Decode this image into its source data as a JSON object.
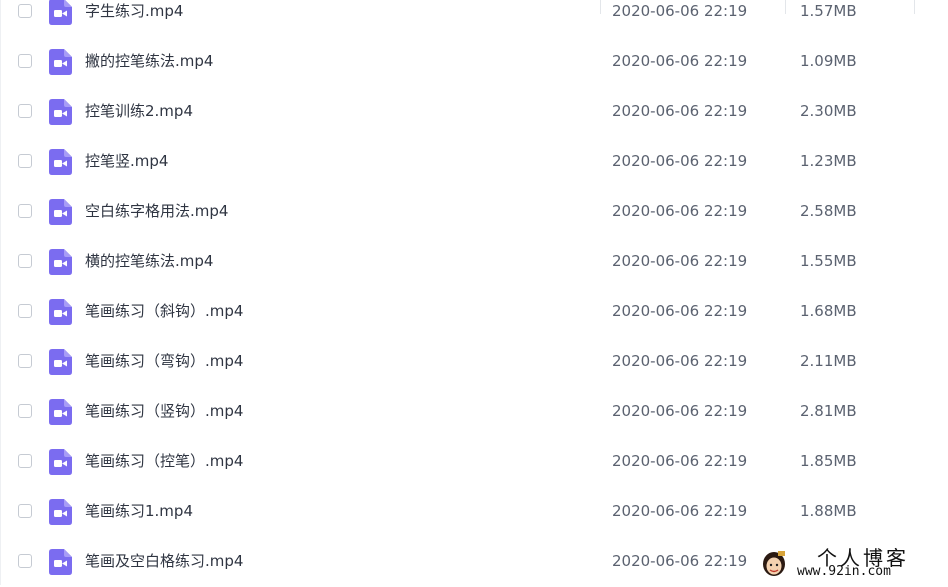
{
  "files": [
    {
      "name": "字生练习.mp4",
      "date": "2020-06-06 22:19",
      "size": "1.57MB"
    },
    {
      "name": "撇的控笔练法.mp4",
      "date": "2020-06-06 22:19",
      "size": "1.09MB"
    },
    {
      "name": "控笔训练2.mp4",
      "date": "2020-06-06 22:19",
      "size": "2.30MB"
    },
    {
      "name": "控笔竖.mp4",
      "date": "2020-06-06 22:19",
      "size": "1.23MB"
    },
    {
      "name": "空白练字格用法.mp4",
      "date": "2020-06-06 22:19",
      "size": "2.58MB"
    },
    {
      "name": "横的控笔练法.mp4",
      "date": "2020-06-06 22:19",
      "size": "1.55MB"
    },
    {
      "name": "笔画练习（斜钩）.mp4",
      "date": "2020-06-06 22:19",
      "size": "1.68MB"
    },
    {
      "name": "笔画练习（弯钩）.mp4",
      "date": "2020-06-06 22:19",
      "size": "2.11MB"
    },
    {
      "name": "笔画练习（竖钩）.mp4",
      "date": "2020-06-06 22:19",
      "size": "2.81MB"
    },
    {
      "name": "笔画练习（控笔）.mp4",
      "date": "2020-06-06 22:19",
      "size": "1.85MB"
    },
    {
      "name": "笔画练习1.mp4",
      "date": "2020-06-06 22:19",
      "size": "1.88MB"
    },
    {
      "name": "笔画及空白格练习.mp4",
      "date": "2020-06-06 22:19",
      "size": ""
    }
  ],
  "file_icon": "video-file-icon",
  "icon_color": "#7b6cf0",
  "watermark": {
    "title": "个人博客",
    "url": "www.92in.com"
  }
}
